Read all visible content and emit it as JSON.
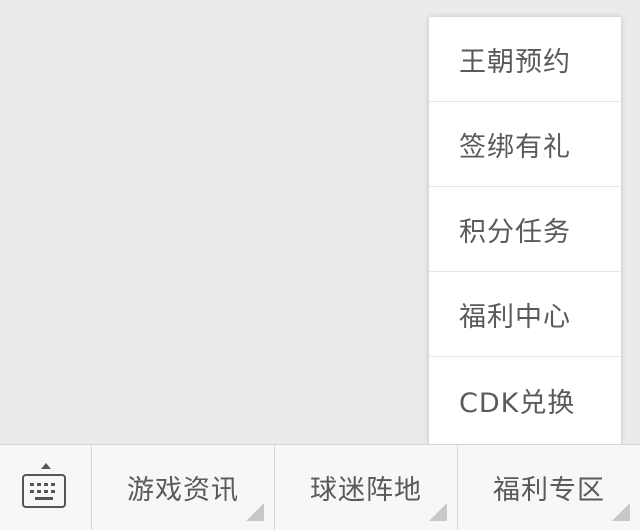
{
  "popup_menu": {
    "items": [
      {
        "label": "王朝预约"
      },
      {
        "label": "签绑有礼"
      },
      {
        "label": "积分任务"
      },
      {
        "label": "福利中心"
      },
      {
        "label": "CDK兑换"
      }
    ]
  },
  "bottom_bar": {
    "keyboard_toggle_icon": "keyboard-icon",
    "tabs": [
      {
        "label": "游戏资讯"
      },
      {
        "label": "球迷阵地"
      },
      {
        "label": "福利专区"
      }
    ]
  },
  "colors": {
    "background": "#ebebeb",
    "menu_background": "#ffffff",
    "bar_background": "#f7f7f7",
    "text": "#5a5a5a"
  }
}
